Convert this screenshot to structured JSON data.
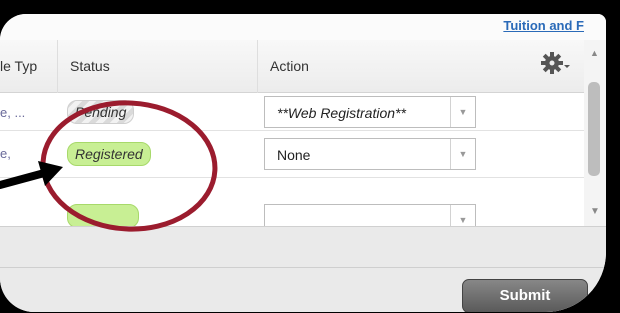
{
  "top_link": "Tuition and F",
  "table": {
    "headers": {
      "type": "le Typ",
      "status": "Status",
      "action": "Action"
    },
    "rows": [
      {
        "type": "e, ...",
        "status": "Pending",
        "action": "**Web Registration**"
      },
      {
        "type": "e,",
        "status": "Registered",
        "action": "None"
      }
    ]
  },
  "footer": {
    "submit_label": "Submit"
  },
  "icons": {
    "settings": "gear-icon",
    "dropdown": "chevron-down-icon",
    "annotation_arrow": "arrow-icon"
  },
  "colors": {
    "link": "#2a6ab8",
    "registered": "#c8ef94",
    "circle": "#9b1c2e",
    "submit": "#6b6b6b"
  }
}
